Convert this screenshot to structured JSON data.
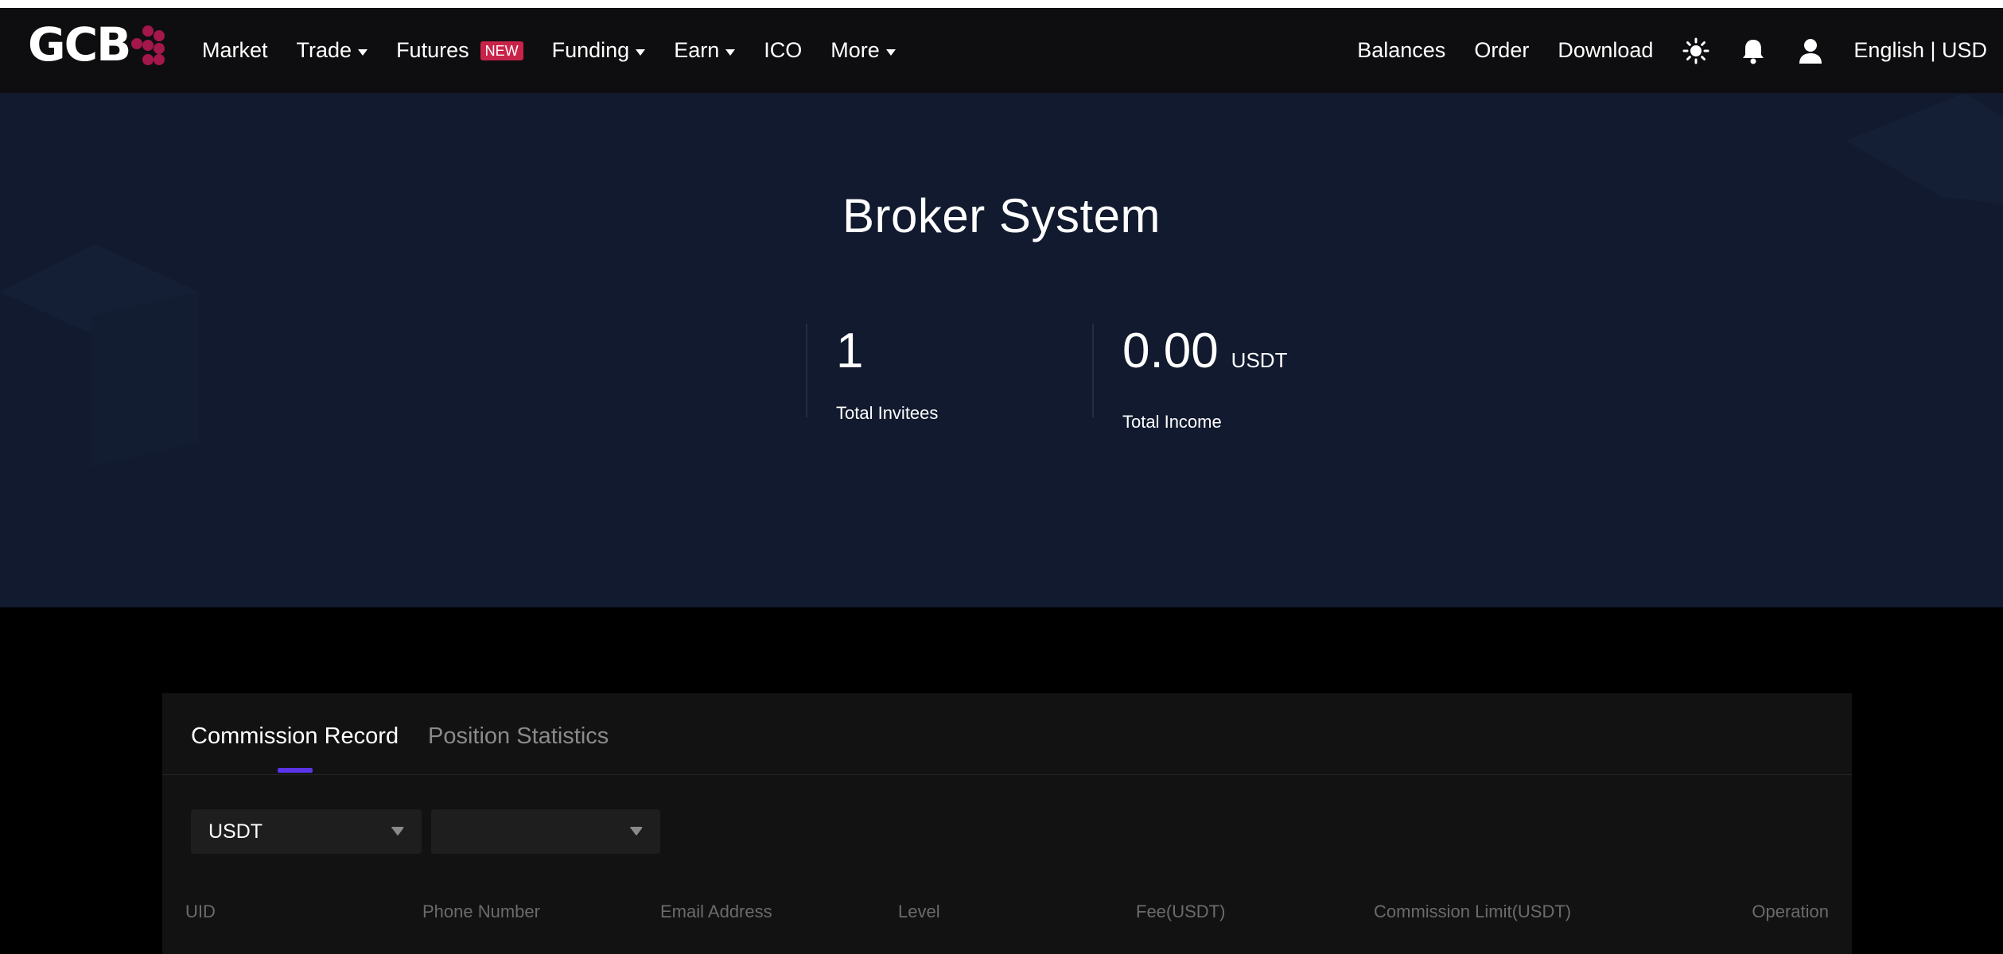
{
  "header": {
    "logo_text": "GCB",
    "nav": [
      {
        "label": "Market",
        "dropdown": false
      },
      {
        "label": "Trade",
        "dropdown": true
      },
      {
        "label": "Futures",
        "dropdown": false,
        "badge": "NEW"
      },
      {
        "label": "Funding",
        "dropdown": true
      },
      {
        "label": "Earn",
        "dropdown": true
      },
      {
        "label": "ICO",
        "dropdown": false
      },
      {
        "label": "More",
        "dropdown": true
      }
    ],
    "right_links": {
      "balances": "Balances",
      "order": "Order",
      "download": "Download",
      "language_currency": "English | USD"
    },
    "icons": [
      "sun-icon",
      "bell-icon",
      "user-icon"
    ]
  },
  "hero": {
    "title": "Broker System",
    "stats": [
      {
        "value": "1",
        "unit": "",
        "label": "Total Invitees"
      },
      {
        "value": "0.00",
        "unit": "USDT",
        "label": "Total Income"
      }
    ]
  },
  "panel": {
    "tabs": [
      {
        "label": "Commission Record",
        "active": true
      },
      {
        "label": "Position Statistics",
        "active": false
      }
    ],
    "filters": [
      {
        "value": ""
      },
      {
        "value": ""
      }
    ],
    "filter_currency": "USDT",
    "table_headers": [
      "UID",
      "Phone Number",
      "Email Address",
      "Level",
      "Fee(USDT)",
      "Commission Limit(USDT)",
      "Operation"
    ]
  },
  "colors": {
    "header_bg": "#0e0e10",
    "hero_bg": "#111a2e",
    "page_bg": "#000000",
    "panel_bg": "#121212",
    "brand": "#a3174b",
    "badge": "#c8244a",
    "accent": "#5a34e6"
  }
}
